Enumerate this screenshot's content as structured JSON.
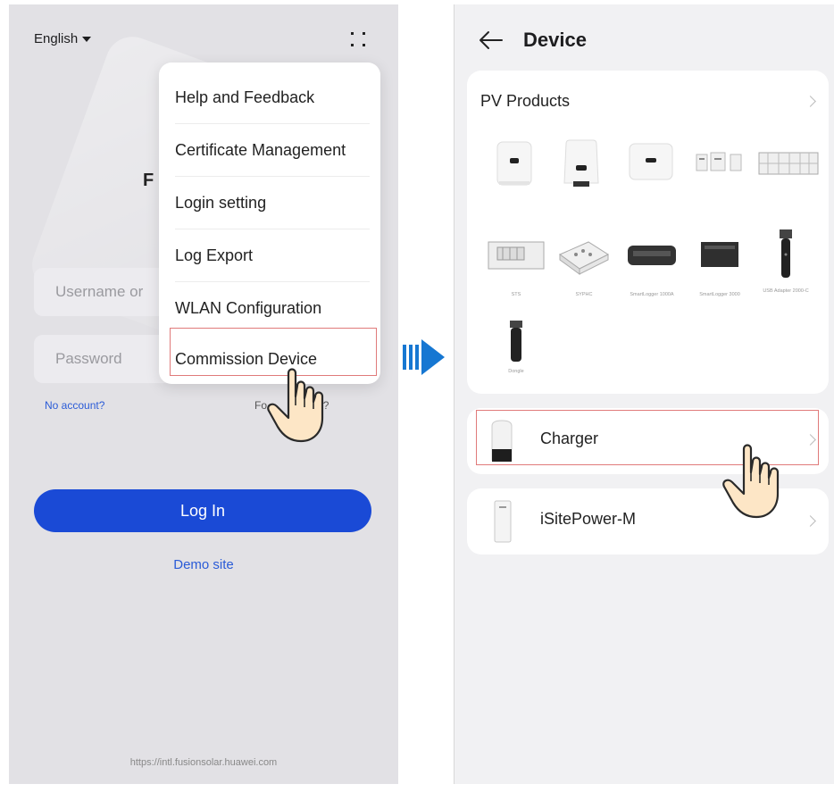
{
  "login": {
    "language": "English",
    "title_partial": "F",
    "username_placeholder": "Username or",
    "password_placeholder": "Password",
    "no_account": "No account?",
    "forgot_password_partial": "Fo           word?",
    "login_button": "Log In",
    "demo_site": "Demo site",
    "server_url": "https://intl.fusionsolar.huawei.com"
  },
  "menu": {
    "items": [
      {
        "label": "Help and Feedback"
      },
      {
        "label": "Certificate Management"
      },
      {
        "label": "Login setting"
      },
      {
        "label": "Log Export"
      },
      {
        "label": "WLAN Configuration"
      },
      {
        "label": "Commission Device"
      }
    ],
    "highlighted": "Commission Device"
  },
  "device_page": {
    "title": "Device",
    "pv_section": {
      "title": "PV Products",
      "products": [
        {
          "label": ""
        },
        {
          "label": ""
        },
        {
          "label": ""
        },
        {
          "label": ""
        },
        {
          "label": ""
        },
        {
          "label": "STS"
        },
        {
          "label": "SYPHC"
        },
        {
          "label": "SmartLogger 1000A"
        },
        {
          "label": "SmartLogger 3000"
        },
        {
          "label": "USB Adapter 2000-C"
        },
        {
          "label": "Dongle"
        }
      ]
    },
    "rows": [
      {
        "label": "Charger"
      },
      {
        "label": "iSitePower-M"
      }
    ]
  },
  "colors": {
    "primary_blue": "#1a4ad6",
    "link_blue": "#2a5bd7",
    "highlight_red": "#e07a7a",
    "arrow_blue": "#1677d2"
  }
}
